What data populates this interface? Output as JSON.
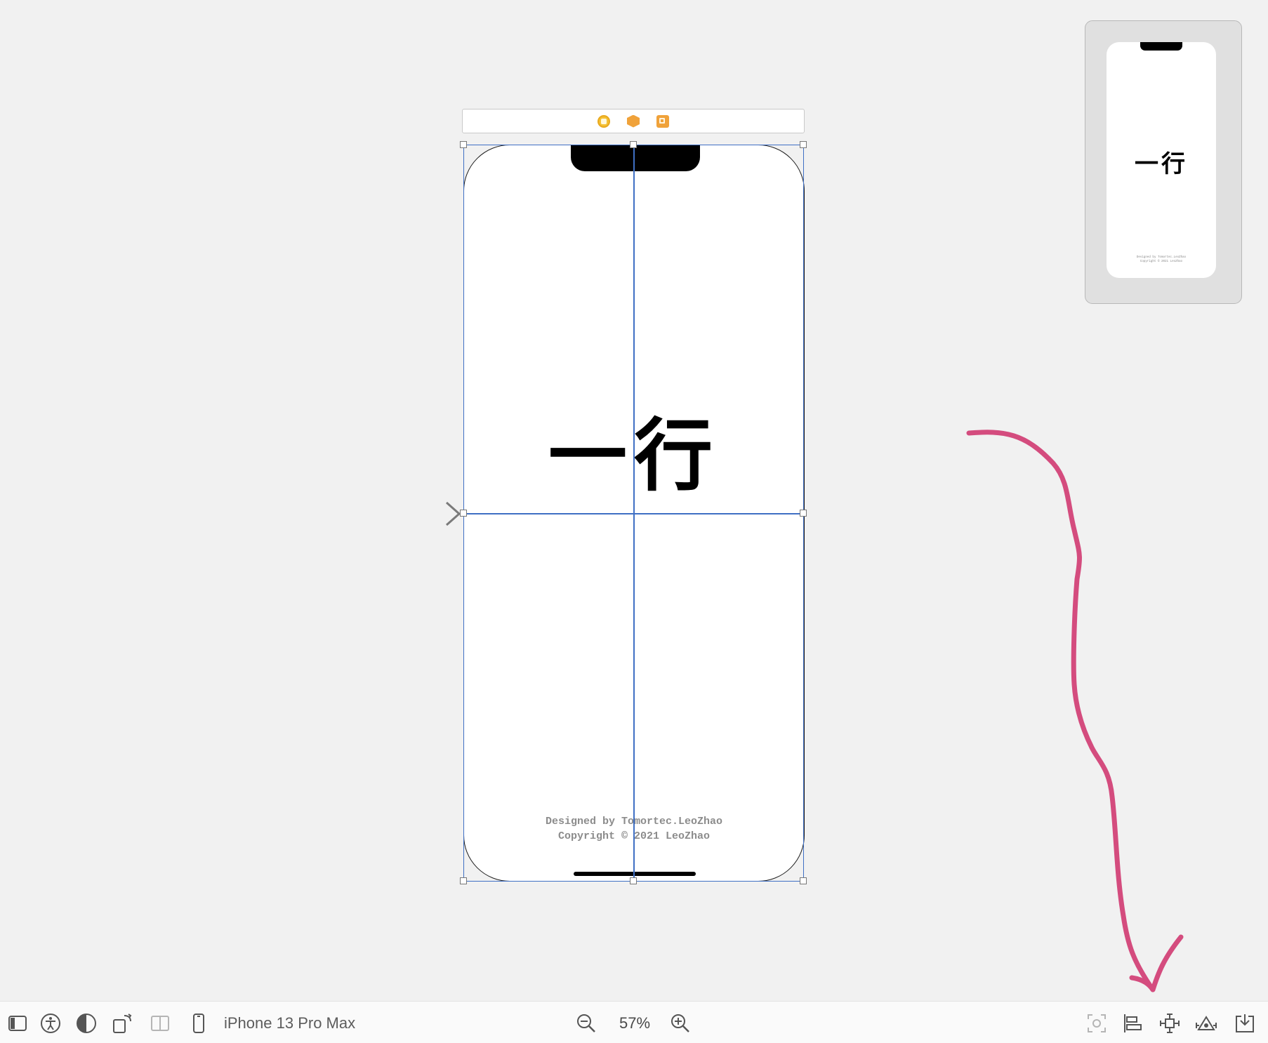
{
  "canvas": {
    "scene_title": "一行",
    "footer_lines": [
      "Designed by Tomortec.LeoZhao",
      "Copyright © 2021 LeoZhao"
    ],
    "dock_icons": [
      "view-controller-icon",
      "first-responder-icon",
      "exit-icon"
    ]
  },
  "minimap": {
    "scene_title": "一行",
    "footer_lines": [
      "Designed by Tomortec.LeoZhao",
      "Copyright © 2021 LeoZhao"
    ]
  },
  "bottom_bar": {
    "left_icons": [
      "document-outline-toggle-icon",
      "accessibility-icon",
      "appearance-icon",
      "orientation-icon",
      "split-view-icon",
      "device-icon"
    ],
    "device_name": "iPhone 13 Pro Max",
    "zoom_out_icon": "zoom-out-icon",
    "zoom_level": "57%",
    "zoom_in_icon": "zoom-in-icon",
    "right_icons": [
      "update-frames-icon",
      "align-icon",
      "add-constraints-icon",
      "resolve-auto-layout-icon",
      "embed-in-icon"
    ]
  },
  "colors": {
    "canvas_bg": "#f1f1f1",
    "selection": "#3f6fc4",
    "annotation": "#d44c7e"
  }
}
